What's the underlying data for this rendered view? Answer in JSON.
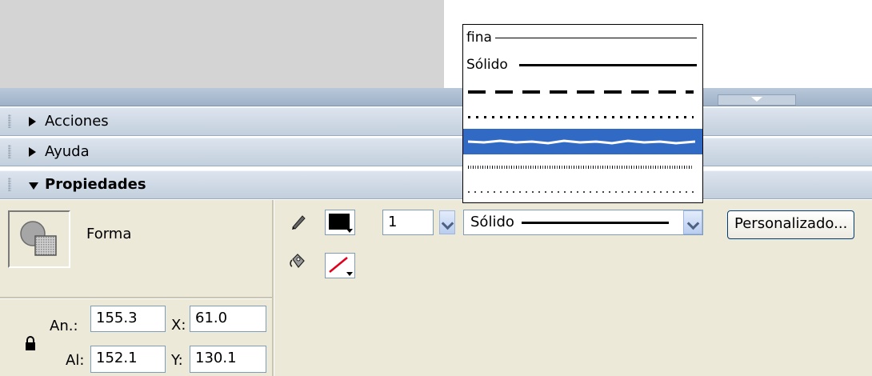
{
  "panels": {
    "acciones": "Acciones",
    "ayuda": "Ayuda",
    "propiedades": "Propiedades"
  },
  "properties": {
    "shape_type": "Forma",
    "stroke_color": "#000000",
    "stroke_width_value": "1",
    "stroke_style_selected": "Sólido",
    "custom_button": "Personalizado...",
    "width_label": "An.:",
    "width_value": "155.3",
    "height_label": "Al:",
    "height_value": "152.1",
    "x_label": "X:",
    "x_value": "61.0",
    "y_label": "Y:",
    "y_value": "130.1"
  },
  "stroke_style_options": [
    {
      "label": "fina",
      "style": "hairline"
    },
    {
      "label": "Sólido",
      "style": "solid"
    },
    {
      "label": "",
      "style": "dashed"
    },
    {
      "label": "",
      "style": "dotted"
    },
    {
      "label": "",
      "style": "ragged",
      "selected": true
    },
    {
      "label": "",
      "style": "stippled"
    },
    {
      "label": "",
      "style": "hatched"
    }
  ],
  "colors": {
    "panel_header": "#c3cfdd",
    "panel_body": "#ece9d8",
    "selection": "#316ac5",
    "no_color_slash": "#e0001b"
  }
}
